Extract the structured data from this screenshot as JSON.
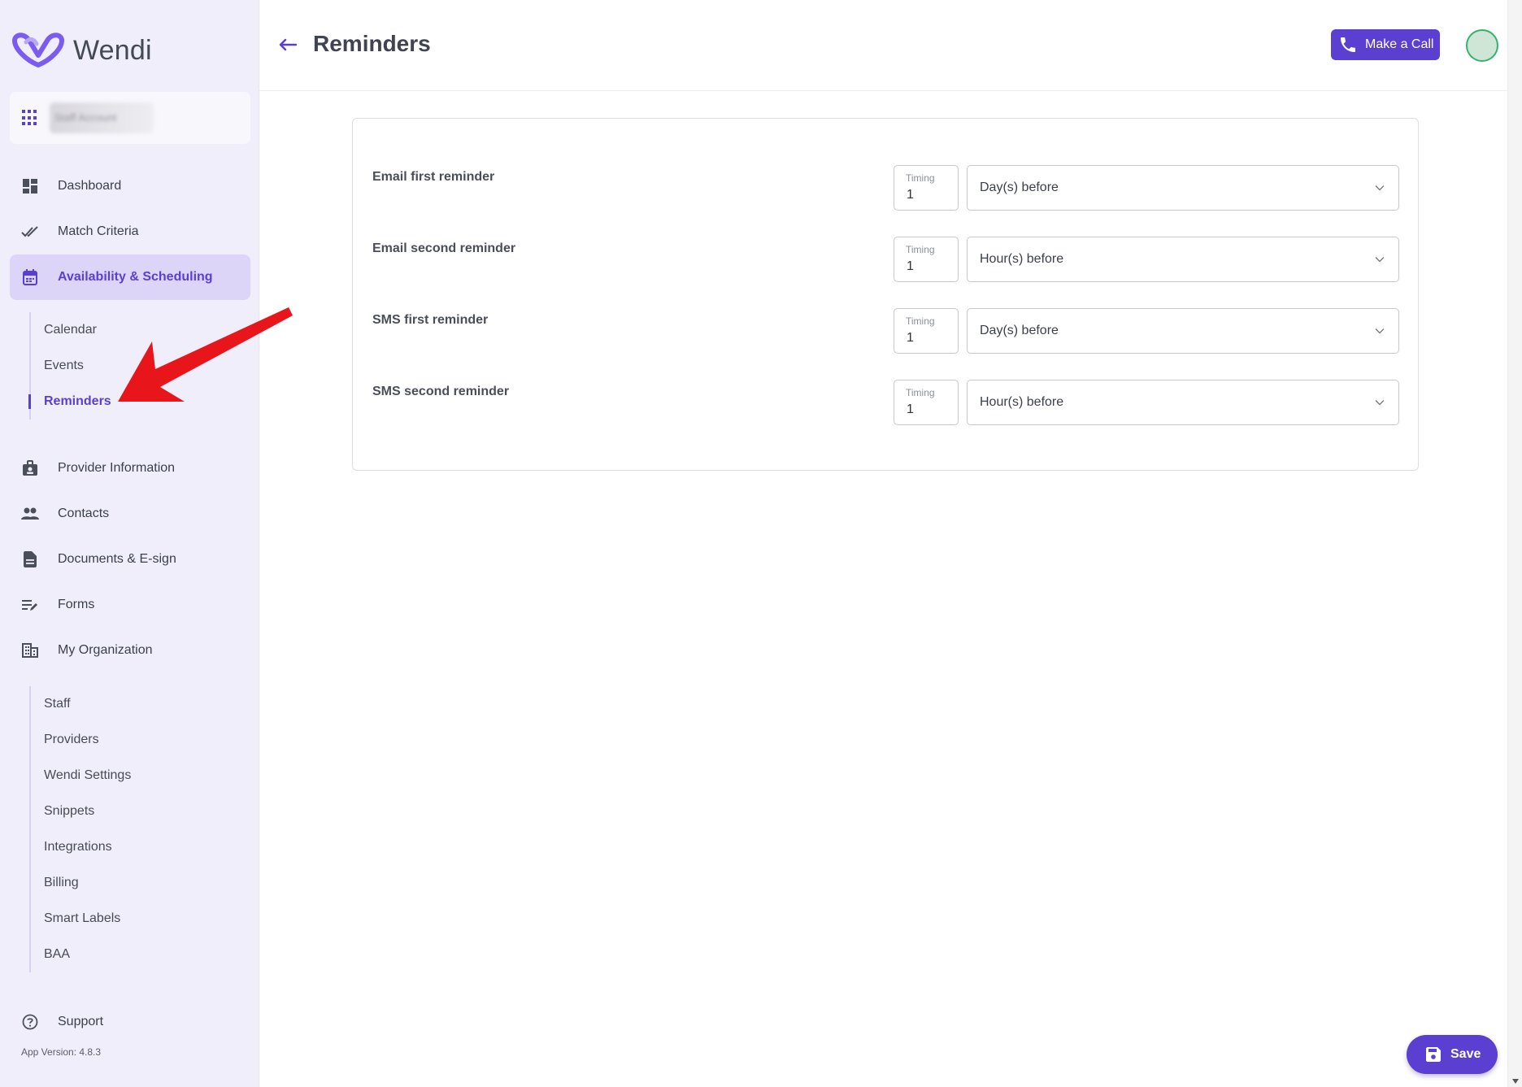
{
  "app": {
    "name": "Wendi",
    "brand_color": "#5b3fd1",
    "version_label": "App Version: 4.8.3"
  },
  "org_switcher": {
    "icon": "apps-grid-icon",
    "name": "Staff Account"
  },
  "sidebar": {
    "items": [
      {
        "label": "Dashboard",
        "icon": "dashboard-icon"
      },
      {
        "label": "Match Criteria",
        "icon": "double-check-icon"
      },
      {
        "label": "Availability & Scheduling",
        "icon": "calendar-icon",
        "active": true
      },
      {
        "label": "Provider Information",
        "icon": "id-badge-icon"
      },
      {
        "label": "Contacts",
        "icon": "people-icon"
      },
      {
        "label": "Documents & E-sign",
        "icon": "document-icon"
      },
      {
        "label": "Forms",
        "icon": "edit-list-icon"
      },
      {
        "label": "My Organization",
        "icon": "building-icon"
      },
      {
        "label": "Support",
        "icon": "help-circle-icon"
      }
    ],
    "scheduling_sub": [
      "Calendar",
      "Events",
      "Reminders"
    ],
    "organization_sub": [
      "Staff",
      "Providers",
      "Wendi Settings",
      "Snippets",
      "Integrations",
      "Billing",
      "Smart Labels",
      "BAA"
    ]
  },
  "header": {
    "title": "Reminders",
    "back_icon": "arrow-left-icon",
    "call_button": {
      "label": "Make a Call",
      "icon": "phone-icon"
    }
  },
  "reminders": {
    "timing_label": "Timing",
    "rows": [
      {
        "label": "Email first reminder",
        "timing": "1",
        "unit": "Day(s) before"
      },
      {
        "label": "Email second reminder",
        "timing": "1",
        "unit": "Hour(s) before"
      },
      {
        "label": "SMS first reminder",
        "timing": "1",
        "unit": "Day(s) before"
      },
      {
        "label": "SMS second reminder",
        "timing": "1",
        "unit": "Hour(s) before"
      }
    ]
  },
  "save_button": {
    "label": "Save",
    "icon": "floppy-disk-icon"
  },
  "annotation": {
    "color": "#e8161b"
  }
}
